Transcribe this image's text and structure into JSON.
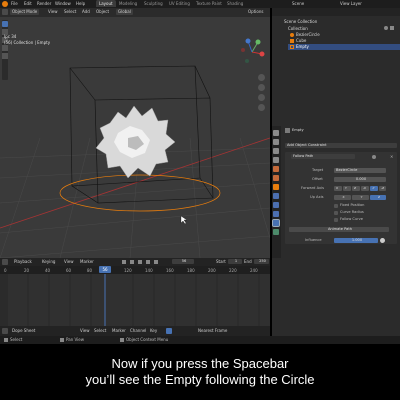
{
  "app": {
    "menu": [
      "File",
      "Edit",
      "Render",
      "Window",
      "Help"
    ],
    "workspace_tabs": [
      "Layout",
      "Modeling",
      "Sculpting",
      "UV Editing",
      "Texture Paint",
      "Shading"
    ],
    "active_tab": "Layout",
    "scene_label": "Scene",
    "view_layer_label": "View Layer"
  },
  "viewport": {
    "header": {
      "mode": "Object Mode",
      "menus": [
        "View",
        "Select",
        "Add",
        "Object"
      ],
      "orientation": "Global",
      "options_label": "Options"
    },
    "overlay_line1": "Ipc 34",
    "overlay_line2": "(56) Collection | Empty"
  },
  "outliner": {
    "header_title": "Scene Collection",
    "items": [
      {
        "label": "Collection",
        "depth": 1
      },
      {
        "label": "BezierCircle",
        "depth": 2
      },
      {
        "label": "Cube",
        "depth": 2
      },
      {
        "label": "Empty",
        "depth": 2
      }
    ]
  },
  "properties": {
    "object_name": "Empty",
    "add_constraint": "Add Object Constraint",
    "constraint_name": "Follow Path",
    "rows": {
      "target_label": "Target",
      "target_value": "BezierCircle",
      "offset_label": "Offset",
      "offset_value": "0.000",
      "forward_axis_label": "Forward Axis",
      "forward_axes": [
        "X",
        "Y",
        "Z",
        "-X",
        "-Y",
        "-Z"
      ],
      "up_axis_label": "Up Axis",
      "up_axes": [
        "X",
        "Y",
        "Z"
      ],
      "fixed_position": "Fixed Position",
      "curve_radius": "Curve Radius",
      "follow_curve": "Follow Curve",
      "animate_path": "Animate Path",
      "influence_label": "Influence",
      "influence_value": "1.000"
    }
  },
  "timeline": {
    "menus": [
      "Playback",
      "Keying",
      "View",
      "Marker"
    ],
    "current_frame": "56",
    "start_label": "Start",
    "start_value": "1",
    "end_label": "End",
    "end_value": "250",
    "ruler_ticks": [
      "0",
      "20",
      "40",
      "60",
      "80",
      "100",
      "120",
      "140",
      "160",
      "180",
      "200",
      "220",
      "240"
    ],
    "playhead_frame_label": "56"
  },
  "dopesheet": {
    "mode": "Dope Sheet",
    "menus": [
      "View",
      "Select",
      "Marker",
      "Channel",
      "Key"
    ],
    "interp": "Nearest Frame"
  },
  "statusbar": {
    "left": "Select",
    "middle": "Pan View",
    "right": "Object Context Menu"
  },
  "caption": {
    "line1": "Now if you press the Spacebar",
    "line2": "you’ll see the Empty following the Circle"
  },
  "colors": {
    "accent": "#4772b3",
    "orange": "#e87d0d",
    "viewport_bg": "#3a3a3a"
  }
}
